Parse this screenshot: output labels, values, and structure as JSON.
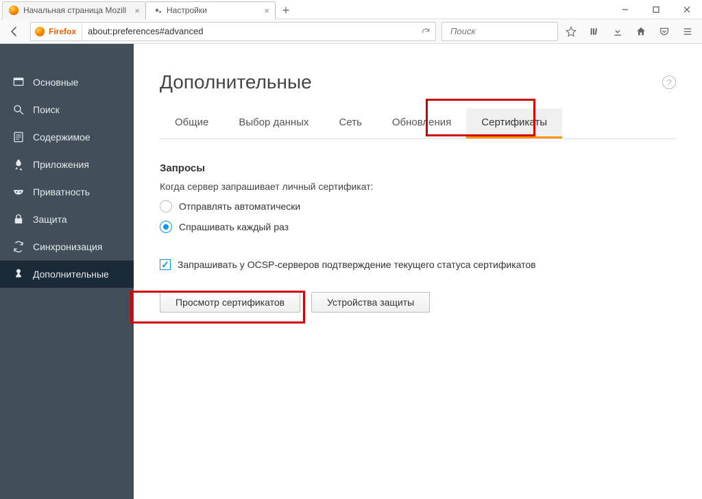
{
  "tabs": [
    {
      "label": "Начальная страница Mozill"
    },
    {
      "label": "Настройки"
    }
  ],
  "urlbar": {
    "brand": "Firefox",
    "value": "about:preferences#advanced"
  },
  "searchbar": {
    "placeholder": "Поиск"
  },
  "sidebar": {
    "items": [
      {
        "label": "Основные"
      },
      {
        "label": "Поиск"
      },
      {
        "label": "Содержимое"
      },
      {
        "label": "Приложения"
      },
      {
        "label": "Приватность"
      },
      {
        "label": "Защита"
      },
      {
        "label": "Синхронизация"
      },
      {
        "label": "Дополнительные"
      }
    ]
  },
  "main": {
    "title": "Дополнительные",
    "subtabs": [
      "Общие",
      "Выбор данных",
      "Сеть",
      "Обновления",
      "Сертификаты"
    ],
    "section": {
      "heading": "Запросы",
      "subtext": "Когда сервер запрашивает личный сертификат:",
      "radio_auto": "Отправлять автоматически",
      "radio_ask": "Спрашивать каждый раз",
      "ocsp": "Запрашивать у OCSP-серверов подтверждение текущего статуса сертификатов"
    },
    "buttons": {
      "view_certs": "Просмотр сертификатов",
      "sec_devices": "Устройства защиты"
    }
  }
}
